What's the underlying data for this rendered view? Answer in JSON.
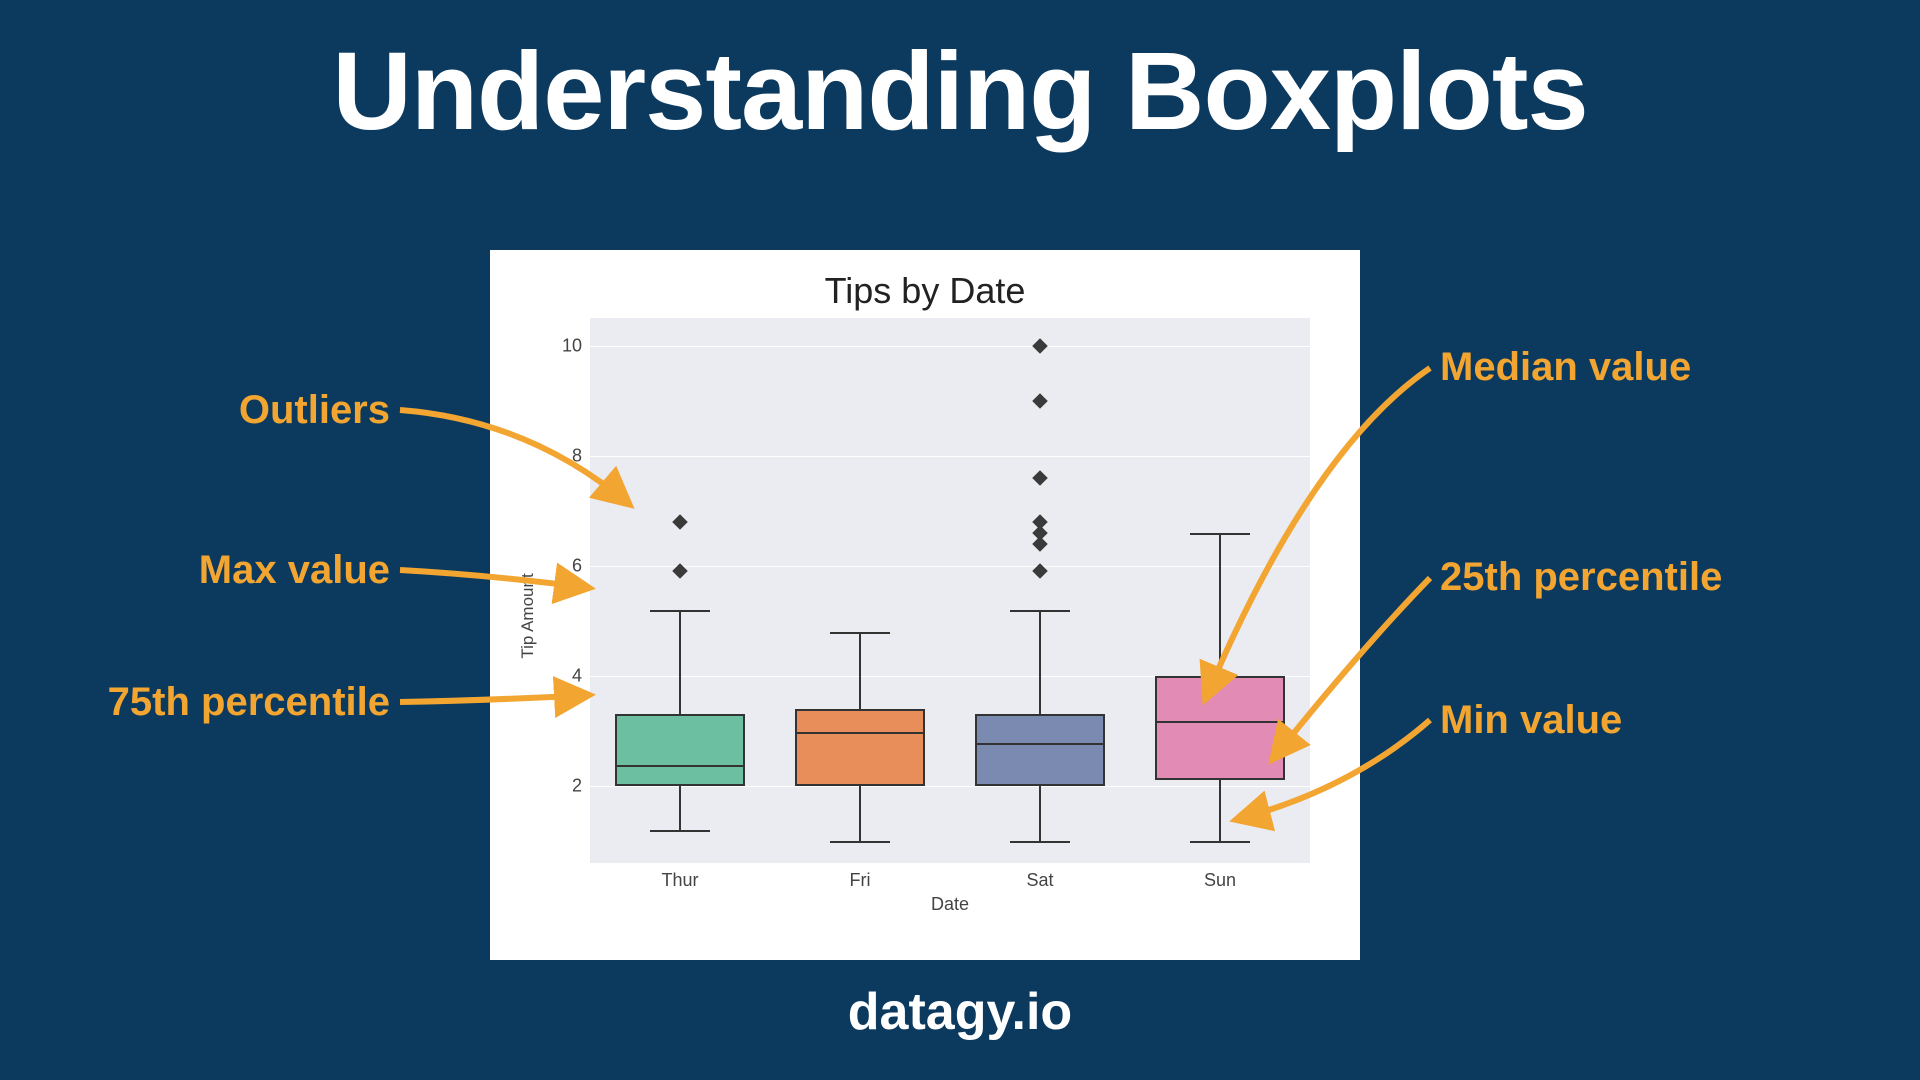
{
  "page": {
    "title": "Understanding Boxplots",
    "footer": "datagy.io"
  },
  "annotations": {
    "outliers": "Outliers",
    "max": "Max value",
    "p75": "75th percentile",
    "median": "Median value",
    "p25": "25th percentile",
    "min": "Min value"
  },
  "chart_data": {
    "type": "boxplot",
    "title": "Tips by Date",
    "xlabel": "Date",
    "ylabel": "Tip Amount",
    "ylim": [
      0.6,
      10.5
    ],
    "yticks": [
      2,
      4,
      6,
      8,
      10
    ],
    "categories": [
      "Thur",
      "Fri",
      "Sat",
      "Sun"
    ],
    "series": [
      {
        "name": "Thur",
        "min": 1.2,
        "q1": 2.0,
        "median": 2.4,
        "q3": 3.3,
        "max": 5.2,
        "outliers": [
          5.9,
          6.8
        ],
        "color": "#6dbfa1"
      },
      {
        "name": "Fri",
        "min": 1.0,
        "q1": 2.0,
        "median": 3.0,
        "q3": 3.4,
        "max": 4.8,
        "outliers": [],
        "color": "#e88e5a"
      },
      {
        "name": "Sat",
        "min": 1.0,
        "q1": 2.0,
        "median": 2.8,
        "q3": 3.3,
        "max": 5.2,
        "outliers": [
          5.9,
          6.4,
          6.6,
          6.8,
          7.6,
          9.0,
          10.0
        ],
        "color": "#7b8ab0"
      },
      {
        "name": "Sun",
        "min": 1.0,
        "q1": 2.1,
        "median": 3.2,
        "q3": 4.0,
        "max": 6.6,
        "outliers": [],
        "color": "#e28bb5"
      }
    ]
  }
}
